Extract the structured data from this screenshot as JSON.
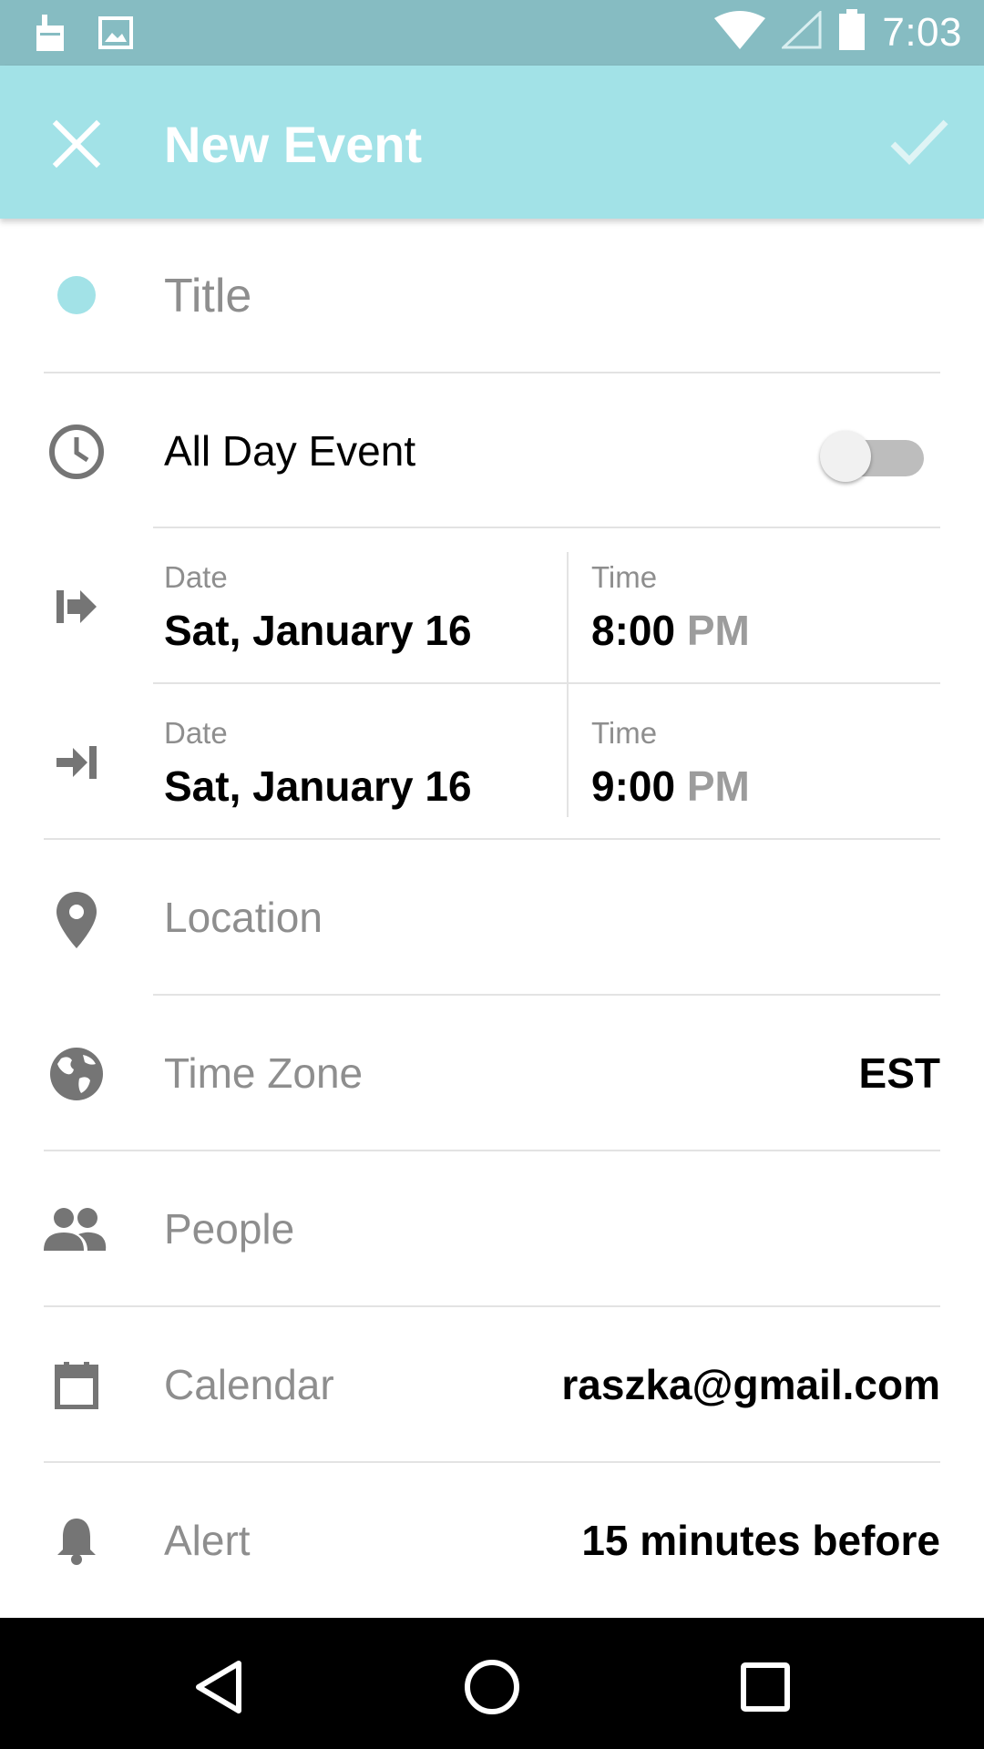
{
  "status_bar": {
    "time": "7:03",
    "icons": [
      "sd-card-icon",
      "image-icon",
      "wifi-icon",
      "signal-icon",
      "battery-icon"
    ]
  },
  "app_bar": {
    "title": "New Event",
    "close_icon": "close-icon",
    "confirm_icon": "check-icon",
    "background": "#a2e2e7"
  },
  "form": {
    "title_field": {
      "placeholder": "Title",
      "value": "",
      "color_dot": "#a2e2e7"
    },
    "all_day": {
      "label": "All Day Event",
      "enabled": false
    },
    "start": {
      "date_label": "Date",
      "date": "Sat, January 16",
      "time_label": "Time",
      "time": "8:00",
      "ampm": "PM"
    },
    "end": {
      "date_label": "Date",
      "date": "Sat, January 16",
      "time_label": "Time",
      "time": "9:00",
      "ampm": "PM"
    },
    "location": {
      "placeholder": "Location"
    },
    "time_zone": {
      "label": "Time Zone",
      "value": "EST"
    },
    "people": {
      "placeholder": "People"
    },
    "calendar": {
      "label": "Calendar",
      "value": "raszka@gmail.com"
    },
    "alert": {
      "label": "Alert",
      "value": "15 minutes before"
    }
  },
  "nav_bar": {
    "icons": [
      "back-icon",
      "home-icon",
      "recents-icon"
    ]
  }
}
